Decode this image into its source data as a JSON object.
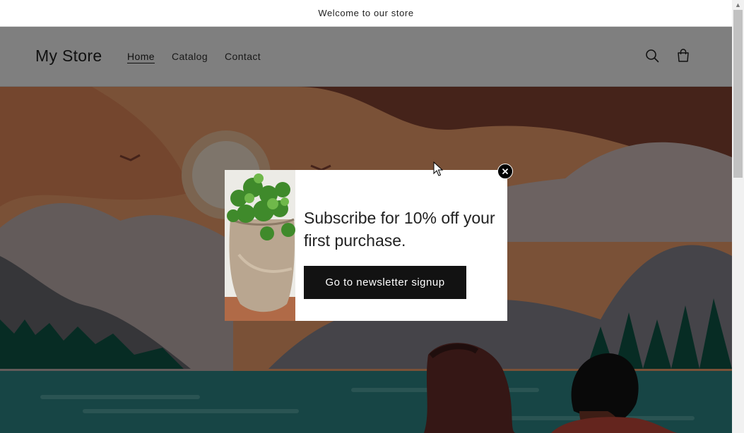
{
  "announcement": {
    "text": "Welcome to our store"
  },
  "header": {
    "logo": "My Store",
    "nav": [
      {
        "label": "Home",
        "active": true
      },
      {
        "label": "Catalog",
        "active": false
      },
      {
        "label": "Contact",
        "active": false
      }
    ],
    "icons": [
      "search-icon",
      "cart-icon"
    ]
  },
  "popup": {
    "title": "Subscribe for 10% off your first purchase.",
    "button_label": "Go to newsletter signup",
    "close_icon": "close-icon"
  },
  "colors": {
    "button_bg": "#121212",
    "overlay": "rgba(0,0,0,0.5)",
    "lake": "#2f8a8a",
    "sky": "#f5a873"
  }
}
